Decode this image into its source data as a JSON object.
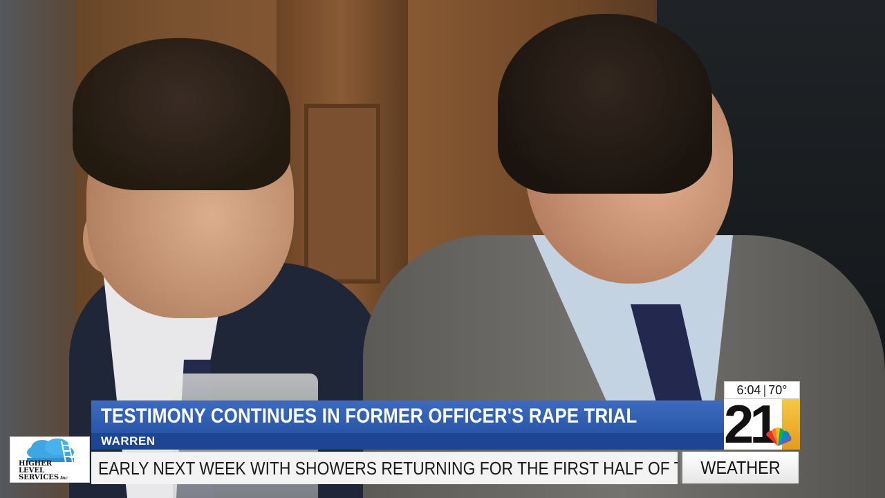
{
  "lower_third": {
    "headline": "TESTIMONY CONTINUES IN FORMER OFFICER'S RAPE TRIAL",
    "location": "WARREN"
  },
  "ticker": {
    "text": "EARLY NEXT WEEK WITH SHOWERS RETURNING FOR THE FIRST HALF OF THE WE",
    "segment_label": "WEATHER"
  },
  "station_bug": {
    "time": "6:04",
    "temperature": "70°",
    "channel": "21",
    "accent_color": "#f0b430"
  },
  "sponsor": {
    "line1": "HIGHER",
    "line2": "LEVEL",
    "line3": "SERVICES",
    "suffix": "Inc"
  },
  "colors": {
    "headline_bar": "#2f5db3",
    "sub_bar": "#1d4591",
    "ticker_bg": "#f3f3f3"
  }
}
